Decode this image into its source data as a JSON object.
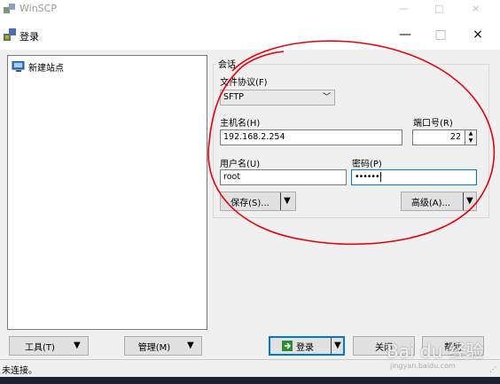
{
  "background_window": {
    "title": "WinSCP"
  },
  "dialog": {
    "title": "登录",
    "controls": {
      "minimize": "—",
      "maximize": "□",
      "close": "×"
    }
  },
  "sites": {
    "items": [
      {
        "label": "新建站点"
      }
    ]
  },
  "session": {
    "group_label": "会话",
    "protocol": {
      "label": "文件协议(F)",
      "value": "SFTP"
    },
    "host": {
      "label": "主机名(H)",
      "value": "192.168.2.254"
    },
    "port": {
      "label": "端口号(R)",
      "value": "22"
    },
    "user": {
      "label": "用户名(U)",
      "value": "root"
    },
    "password": {
      "label": "密码(P)",
      "value": "••••••"
    },
    "save_button": "保存(S)...",
    "advanced_button": "高级(A)..."
  },
  "bottom": {
    "tools_button": "工具(T)",
    "manage_button": "管理(M)",
    "login_button": "登录",
    "close_button": "关闭",
    "help_button": "帮助"
  },
  "status": {
    "text": "未连接。"
  },
  "watermark": {
    "text": "Bai du 经验",
    "url": "jingyan.baidu.com"
  },
  "colors": {
    "annotation": "#e8000b",
    "focus": "#0078d7",
    "dialog_bg": "#f0f0f0"
  }
}
